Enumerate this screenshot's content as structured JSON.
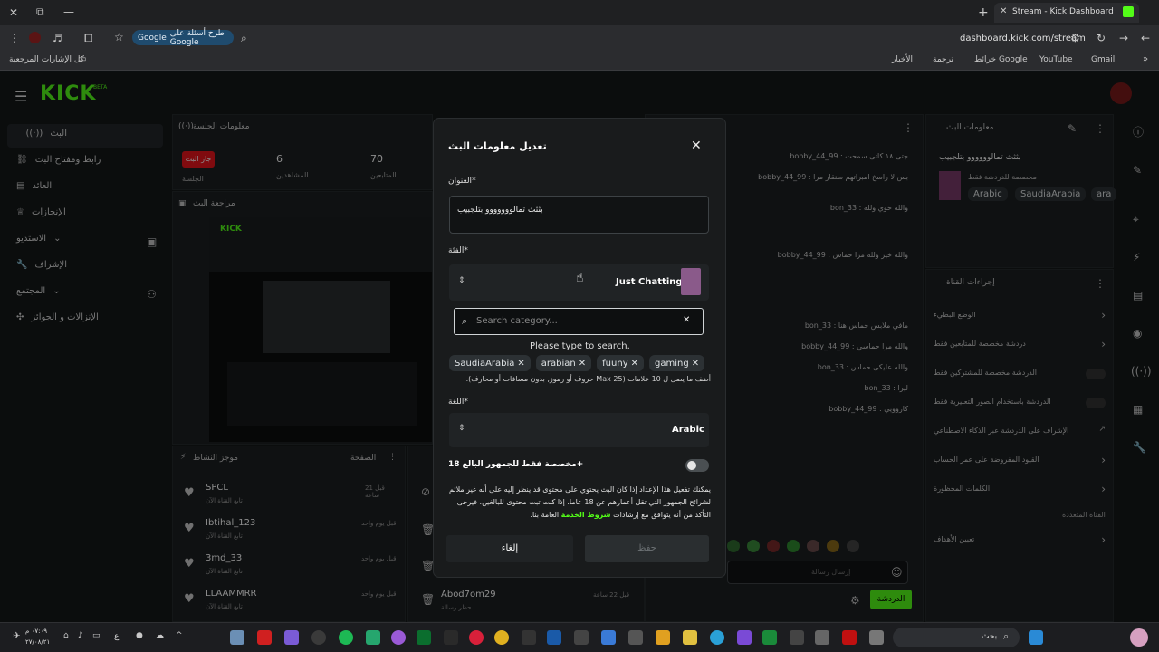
{
  "browser": {
    "tab_title": "Stream - Kick Dashboard",
    "url": "dashboard.kick.com/stream",
    "google_chip": "طرح أسئلة على Google",
    "google_label": "Google",
    "bookmarks": [
      "Gmail",
      "YouTube",
      "خرائط Google",
      "ترجمة",
      "الأخبار"
    ],
    "bookmarks_all": "كل الإشارات المرجعية"
  },
  "app": {
    "logo": "KICK",
    "logo_badge": "BETA",
    "nav": [
      {
        "label": "البث",
        "icon": "broadcast-icon"
      },
      {
        "label": "رابط ومفتاح البث",
        "icon": "link-icon"
      },
      {
        "label": "العائد",
        "icon": "revenue-icon"
      },
      {
        "label": "الإنجازات",
        "icon": "trophy-icon"
      },
      {
        "label": "الاستديو",
        "icon": "studio-icon"
      },
      {
        "label": "الإشراف",
        "icon": "wrench-icon"
      },
      {
        "label": "المجتمع",
        "icon": "community-icon"
      },
      {
        "label": "الإنزالات و الجوائز",
        "icon": "gift-icon"
      }
    ],
    "session": {
      "title": "معلومات الجلسة",
      "live_badge": "جار البث",
      "stats": [
        {
          "value": "6",
          "label": "المشاهدين"
        },
        {
          "value": "70",
          "label": "المتابعين"
        }
      ],
      "session_label": "الجلسة"
    },
    "preview_title": "مراجعة البث",
    "activity": {
      "title": "موجز النشاط",
      "filter": "الصفحة",
      "items": [
        {
          "name": "SPCL",
          "sub": "تابع القناة الآن",
          "time": "قبل 21 ساعة"
        },
        {
          "name": "Ibtihal_123",
          "sub": "تابع القناة الآن",
          "time": "قبل يوم واحد"
        },
        {
          "name": "3md_33",
          "sub": "تابع القناة الآن",
          "time": "قبل يوم واحد"
        },
        {
          "name": "LLAAMMRR",
          "sub": "تابع القناة الآن",
          "time": "قبل يوم واحد"
        }
      ],
      "extra": {
        "name": "Abod7om29",
        "sub": "حظر رسالة",
        "time": "قبل 22 ساعة"
      }
    },
    "chat": {
      "lines": [
        "جتی ۱۸ کاتی سمحت : bobby_44_99",
        "بس لا راسخ امبراتهم سنقار مرا : bobby_44_99",
        "والله حوي ولله : bon_33",
        "والله خير ولله مرا حماس : bobby_44_99",
        "مافي ملابس حماس هنا : bon_33",
        "والله مرا حماسي : bobby_44_99",
        "والله عليکی حماس : bon_33",
        "ليرا : bon_33",
        "کاروويي : bobby_44_99"
      ],
      "input_placeholder": "إرسال رسالة",
      "send_button": "الدردشة"
    },
    "stream_info": {
      "title": "معلومات البث",
      "stream_title": "بثثث تمالوووووو بتلجبيب",
      "sub": "مخصصة للدردشة فقط",
      "tags": [
        "Arabic",
        "SaudiaArabia",
        "ara"
      ]
    },
    "channel_actions": {
      "title": "إجراءات القناة",
      "items": [
        "الوضع البطيء",
        "دردشة مخصصة للمتابعين فقط",
        "الدردشة مخصصة للمشتركين فقط",
        "الدردشة باستخدام الصور التعبيرية فقط",
        "الإشراف على الدردشة عبر الذكاء الاصطناعي",
        "القيود المفروضة على عمر الحساب",
        "الكلمات المحظورة"
      ],
      "advanced": "القناة المتعددة",
      "goals": "تعيين الأهداف"
    }
  },
  "modal": {
    "title": "تعديل معلومات البث",
    "title_label": "العنوان*",
    "title_value": "بثثث تمالووووووو بتلجبيب",
    "category_label": "الفئة*",
    "category_value": "Just Chatting",
    "search_placeholder": "Search category...",
    "search_hint": "Please type to search.",
    "tags": [
      "SaudiaArabia",
      "arabian",
      "fuuny",
      "gaming"
    ],
    "tags_hint": "أضف ما يصل ل 10 علامات (Max 25 حروف أو رموز, بدون مسافات أو محارف).",
    "language_label": "اللغة*",
    "language_value": "Arabic",
    "mature_label": "مخصصة فقط للجمهور البالغ 18+",
    "mature_text": "يمكنك تفعيل هذا الإعداد إذا كان البث يحتوي على محتوى قد ينظر إليه على أنه غير ملائم لشرائح الجمهور التي تقل أعمارهم عن 18 عاما. إذا كنت تبث محتوى للبالغين، فيرجى التأكد من أنه يتوافق مع إرشادات",
    "mature_link": "شروط الخدمة",
    "mature_text_end": "العامة بنا.",
    "cancel": "إلغاء",
    "save": "حفظ"
  },
  "taskbar": {
    "search": "بحث",
    "time": "٠٧:٠٩ م",
    "date": "٢٧/٠٨/٢١",
    "lang": "ع"
  },
  "colors": {
    "accent": "#53fc18",
    "live": "#e8141c"
  }
}
